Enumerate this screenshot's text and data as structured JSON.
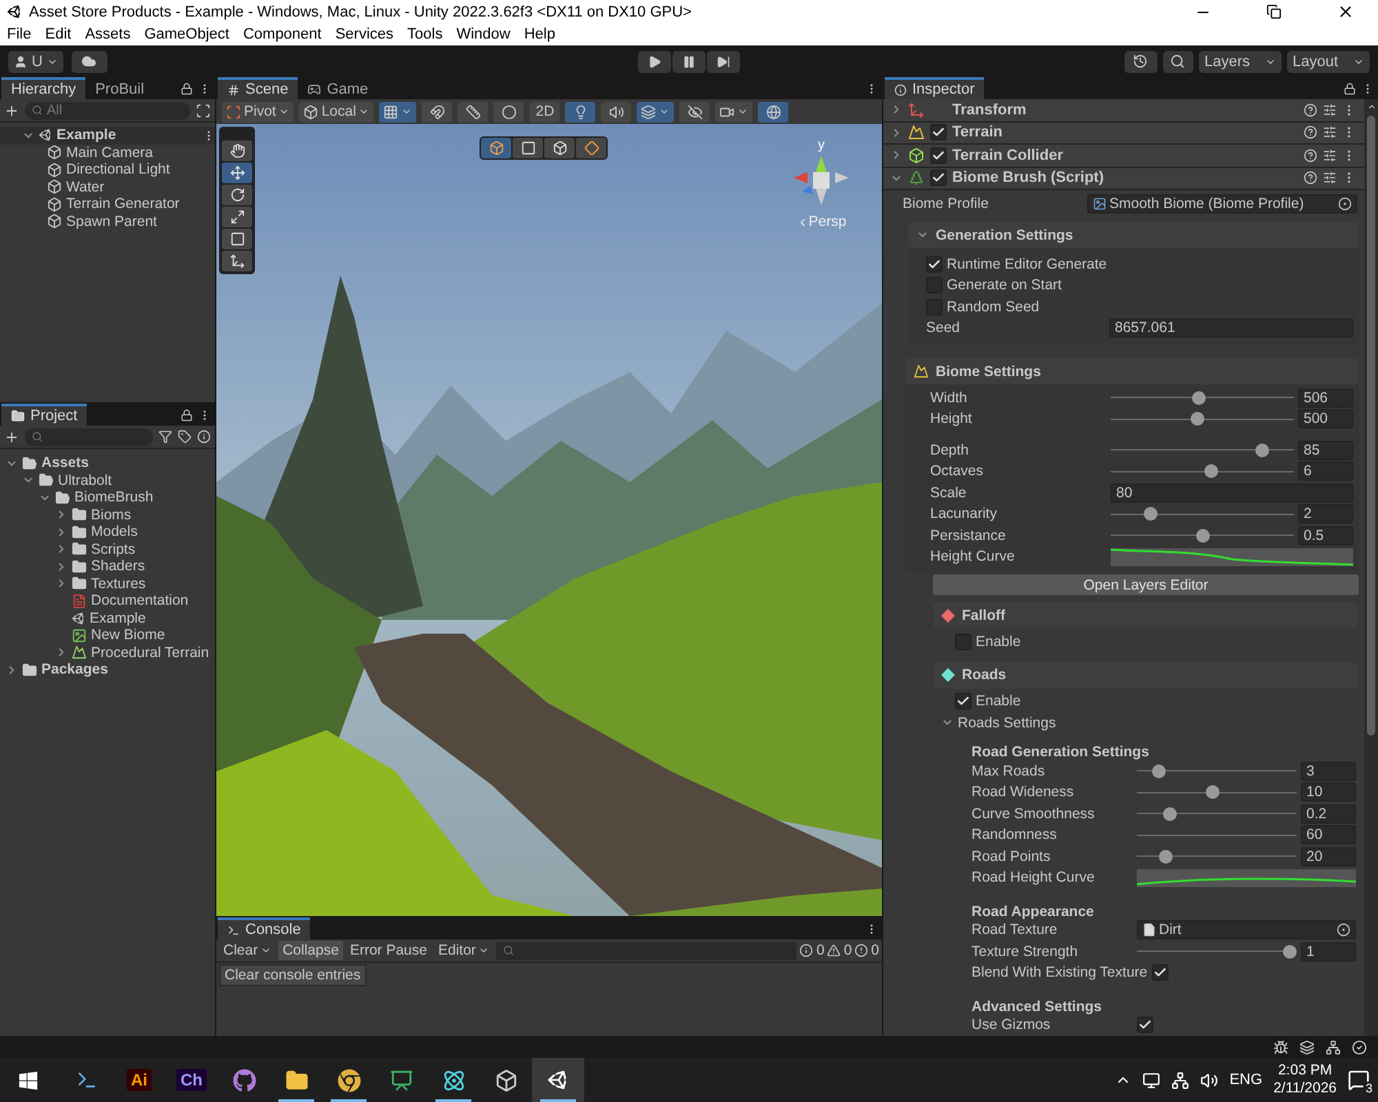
{
  "window": {
    "title": "Asset Store Products - Example - Windows, Mac, Linux - Unity 2022.3.62f3 <DX11 on DX10 GPU>"
  },
  "menu": [
    "File",
    "Edit",
    "Assets",
    "GameObject",
    "Component",
    "Services",
    "Tools",
    "Window",
    "Help"
  ],
  "toolbar": {
    "account": "U",
    "layers": "Layers",
    "layout": "Layout"
  },
  "hierarchy": {
    "tabs": [
      {
        "label": "Hierarchy",
        "selected": true
      },
      {
        "label": "ProBuil",
        "selected": false
      }
    ],
    "search_placeholder": "All",
    "scene": "Example",
    "items": [
      "Main Camera",
      "Directional Light",
      "Water",
      "Terrain Generator",
      "Spawn Parent"
    ]
  },
  "project": {
    "tab": "Project",
    "tree": [
      {
        "label": "Assets",
        "kind": "folder",
        "expanded": true,
        "children": [
          {
            "label": "Ultrabolt",
            "kind": "folder",
            "expanded": true,
            "children": [
              {
                "label": "BiomeBrush",
                "kind": "folder",
                "expanded": true,
                "children": [
                  {
                    "label": "Bioms",
                    "kind": "folder",
                    "expanded": false
                  },
                  {
                    "label": "Models",
                    "kind": "folder",
                    "expanded": false
                  },
                  {
                    "label": "Scripts",
                    "kind": "folder",
                    "expanded": false
                  },
                  {
                    "label": "Shaders",
                    "kind": "folder",
                    "expanded": false
                  },
                  {
                    "label": "Textures",
                    "kind": "folder",
                    "expanded": false
                  },
                  {
                    "label": "Documentation",
                    "kind": "pdf"
                  },
                  {
                    "label": "Example",
                    "kind": "scene"
                  },
                  {
                    "label": "New Biome",
                    "kind": "biome"
                  },
                  {
                    "label": "Procedural Terrain",
                    "kind": "terrain",
                    "expanded": false
                  }
                ]
              }
            ]
          }
        ]
      },
      {
        "label": "Packages",
        "kind": "folder",
        "expanded": false
      }
    ]
  },
  "scene": {
    "tabs": [
      {
        "label": "Scene",
        "kind": "scene",
        "selected": true
      },
      {
        "label": "Game",
        "kind": "game",
        "selected": false
      }
    ],
    "toolbar": [
      {
        "kind": "pivot",
        "label": "Pivot"
      },
      {
        "kind": "local",
        "label": "Local"
      },
      {
        "kind": "grid",
        "on": true
      },
      {
        "kind": "snap",
        "on": false
      },
      {
        "kind": "increment",
        "on": false
      },
      {
        "kind": "shading",
        "on": false
      },
      {
        "kind": "flat",
        "label": "2D",
        "on": false
      },
      {
        "kind": "lighting",
        "on": true
      },
      {
        "kind": "audio",
        "on": false
      },
      {
        "kind": "effects",
        "on": true
      },
      {
        "kind": "visibility",
        "on": false
      },
      {
        "kind": "camera",
        "on": false
      },
      {
        "kind": "gizmos",
        "on": true
      }
    ],
    "tools": [
      {
        "kind": "hand",
        "selected": false
      },
      {
        "kind": "move",
        "selected": true
      },
      {
        "kind": "rotate",
        "selected": false
      },
      {
        "kind": "scale",
        "selected": false
      },
      {
        "kind": "rect",
        "selected": false
      },
      {
        "kind": "transform",
        "selected": false
      }
    ],
    "view_options": [
      {
        "kind": "iso",
        "selected": true
      },
      {
        "kind": "rect",
        "selected": false
      },
      {
        "kind": "cube",
        "selected": false
      },
      {
        "kind": "shaded",
        "selected": false
      }
    ],
    "gizmo": {
      "axis": "y",
      "projection": "Persp"
    }
  },
  "console": {
    "tab": "Console",
    "buttons": [
      {
        "label": "Clear",
        "kind": "split",
        "on": false
      },
      {
        "label": "Collapse",
        "kind": "toggle",
        "on": true
      },
      {
        "label": "Error Pause",
        "kind": "toggle",
        "on": false
      },
      {
        "label": "Editor",
        "kind": "dropdown",
        "on": false
      }
    ],
    "counts": [
      {
        "kind": "log",
        "value": "0"
      },
      {
        "kind": "warning",
        "value": "0"
      },
      {
        "kind": "error",
        "value": "0"
      }
    ],
    "entries": [
      "Clear console entries"
    ]
  },
  "inspector": {
    "tab": "Inspector",
    "components": [
      {
        "name": "Transform",
        "kind": "transform",
        "expanded": false
      },
      {
        "name": "Terrain",
        "kind": "terrain",
        "enabled": true,
        "expanded": false
      },
      {
        "name": "Terrain Collider",
        "kind": "collider",
        "enabled": true,
        "expanded": false
      },
      {
        "name": "Biome Brush (Script)",
        "kind": "script",
        "enabled": true,
        "expanded": true
      }
    ],
    "biome_profile": {
      "label": "Biome Profile",
      "value": "Smooth Biome (Biome Profile)"
    },
    "generation": {
      "title": "Generation Settings",
      "expanded": true,
      "toggles": [
        {
          "label": "Runtime Editor Generate",
          "checked": true
        },
        {
          "label": "Generate on Start",
          "checked": false
        },
        {
          "label": "Random Seed",
          "checked": false
        }
      ],
      "seed": {
        "label": "Seed",
        "value": "8657.061"
      }
    },
    "biome": {
      "title": "Biome Settings",
      "rows": [
        {
          "kind": "slider",
          "label": "Width",
          "value": "506",
          "level": 0.48
        },
        {
          "kind": "slider",
          "label": "Height",
          "value": "500",
          "level": 0.47
        },
        {
          "kind": "slider",
          "label": "Depth",
          "value": "85",
          "level": 0.83
        },
        {
          "kind": "slider",
          "label": "Octaves",
          "value": "6",
          "level": 0.55
        },
        {
          "kind": "field",
          "label": "Scale",
          "value": "80"
        },
        {
          "kind": "slider",
          "label": "Lacunarity",
          "value": "2",
          "level": 0.22
        },
        {
          "kind": "slider",
          "label": "Persistance",
          "value": "0.5",
          "level": 0.5
        },
        {
          "kind": "curve",
          "label": "Height Curve"
        }
      ]
    },
    "layers_button": "Open Layers Editor",
    "modules": [
      {
        "title": "Falloff",
        "color": "#e86a6a",
        "enable": {
          "label": "Enable",
          "checked": false
        }
      },
      {
        "title": "Roads",
        "color": "#6fe0d2",
        "enable": {
          "label": "Enable",
          "checked": true
        },
        "settings": {
          "label": "Roads Settings",
          "expanded": true,
          "groups": [
            {
              "title": "Road Generation Settings",
              "rows": [
                {
                  "kind": "slider",
                  "label": "Max Roads",
                  "value": "3",
                  "level": 0.14
                },
                {
                  "kind": "slider",
                  "label": "Road Wideness",
                  "value": "10",
                  "level": 0.47
                },
                {
                  "kind": "slider",
                  "label": "Curve Smoothness",
                  "value": "0.2",
                  "level": 0.21
                },
                {
                  "kind": "track",
                  "label": "Randomness",
                  "value": "60"
                },
                {
                  "kind": "slider",
                  "label": "Road Points",
                  "value": "20",
                  "level": 0.18
                },
                {
                  "kind": "curve",
                  "label": "Road Height Curve"
                }
              ]
            },
            {
              "title": "Road Appearance",
              "rows": [
                {
                  "kind": "object",
                  "label": "Road Texture",
                  "value": "Dirt"
                },
                {
                  "kind": "slider",
                  "label": "Texture Strength",
                  "value": "1",
                  "level": 0.96
                },
                {
                  "kind": "toggle",
                  "label": "Blend With Existing Texture",
                  "checked": true
                }
              ]
            },
            {
              "title": "Advanced Settings",
              "rows": [
                {
                  "kind": "toggle",
                  "label": "Use Gizmos",
                  "checked": true
                }
              ]
            }
          ]
        }
      }
    ]
  },
  "taskbar": {
    "apps": [
      {
        "kind": "terminal",
        "selected": false,
        "running": false
      },
      {
        "kind": "ai",
        "label": "Ai",
        "selected": false,
        "running": false
      },
      {
        "kind": "ch",
        "label": "Ch",
        "selected": false,
        "running": false
      },
      {
        "kind": "cat",
        "selected": false,
        "running": false
      },
      {
        "kind": "explorer",
        "selected": false,
        "running": true
      },
      {
        "kind": "browser",
        "selected": false,
        "running": true
      },
      {
        "kind": "board",
        "selected": false,
        "running": false
      },
      {
        "kind": "editor",
        "selected": false,
        "running": true
      },
      {
        "kind": "hub",
        "selected": false,
        "running": false
      },
      {
        "kind": "unity",
        "selected": true,
        "running": true
      }
    ],
    "language": "ENG",
    "time": "2:03 PM",
    "date": "2/11/2026",
    "notifications": "3"
  }
}
